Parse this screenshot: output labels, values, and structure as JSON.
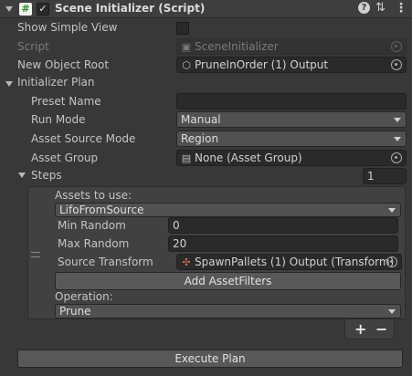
{
  "header": {
    "title": "Scene Initializer (Script)",
    "enabled_check": "✓",
    "script_glyph": "#",
    "help_glyph": "?",
    "settings_glyph": "⇅",
    "menu_glyph": "⋮"
  },
  "props": {
    "show_simple_view": "Show Simple View",
    "script_label": "Script",
    "script_value": "SceneInitializer",
    "new_object_root_label": "New Object Root",
    "new_object_root_value": "PruneInOrder (1) Output",
    "initializer_plan": "Initializer Plan",
    "preset_name_label": "Preset Name",
    "preset_name_value": "",
    "run_mode_label": "Run Mode",
    "run_mode_value": "Manual",
    "asset_source_mode_label": "Asset Source Mode",
    "asset_source_mode_value": "Region",
    "asset_group_label": "Asset Group",
    "asset_group_value": "None (Asset Group)",
    "steps_label": "Steps",
    "steps_count": "1"
  },
  "step": {
    "assets_to_use_label": "Assets to use:",
    "assets_to_use_value": "LifoFromSource",
    "min_random_label": "Min Random",
    "min_random_value": "0",
    "max_random_label": "Max Random",
    "max_random_value": "20",
    "source_transform_label": "Source Transform",
    "source_transform_value": "SpawnPallets (1) Output (Transform)",
    "add_filters_label": "Add AssetFilters",
    "operation_label": "Operation:",
    "operation_value": "Prune"
  },
  "list_controls": {
    "add": "+",
    "remove": "−"
  },
  "execute_label": "Execute Plan"
}
